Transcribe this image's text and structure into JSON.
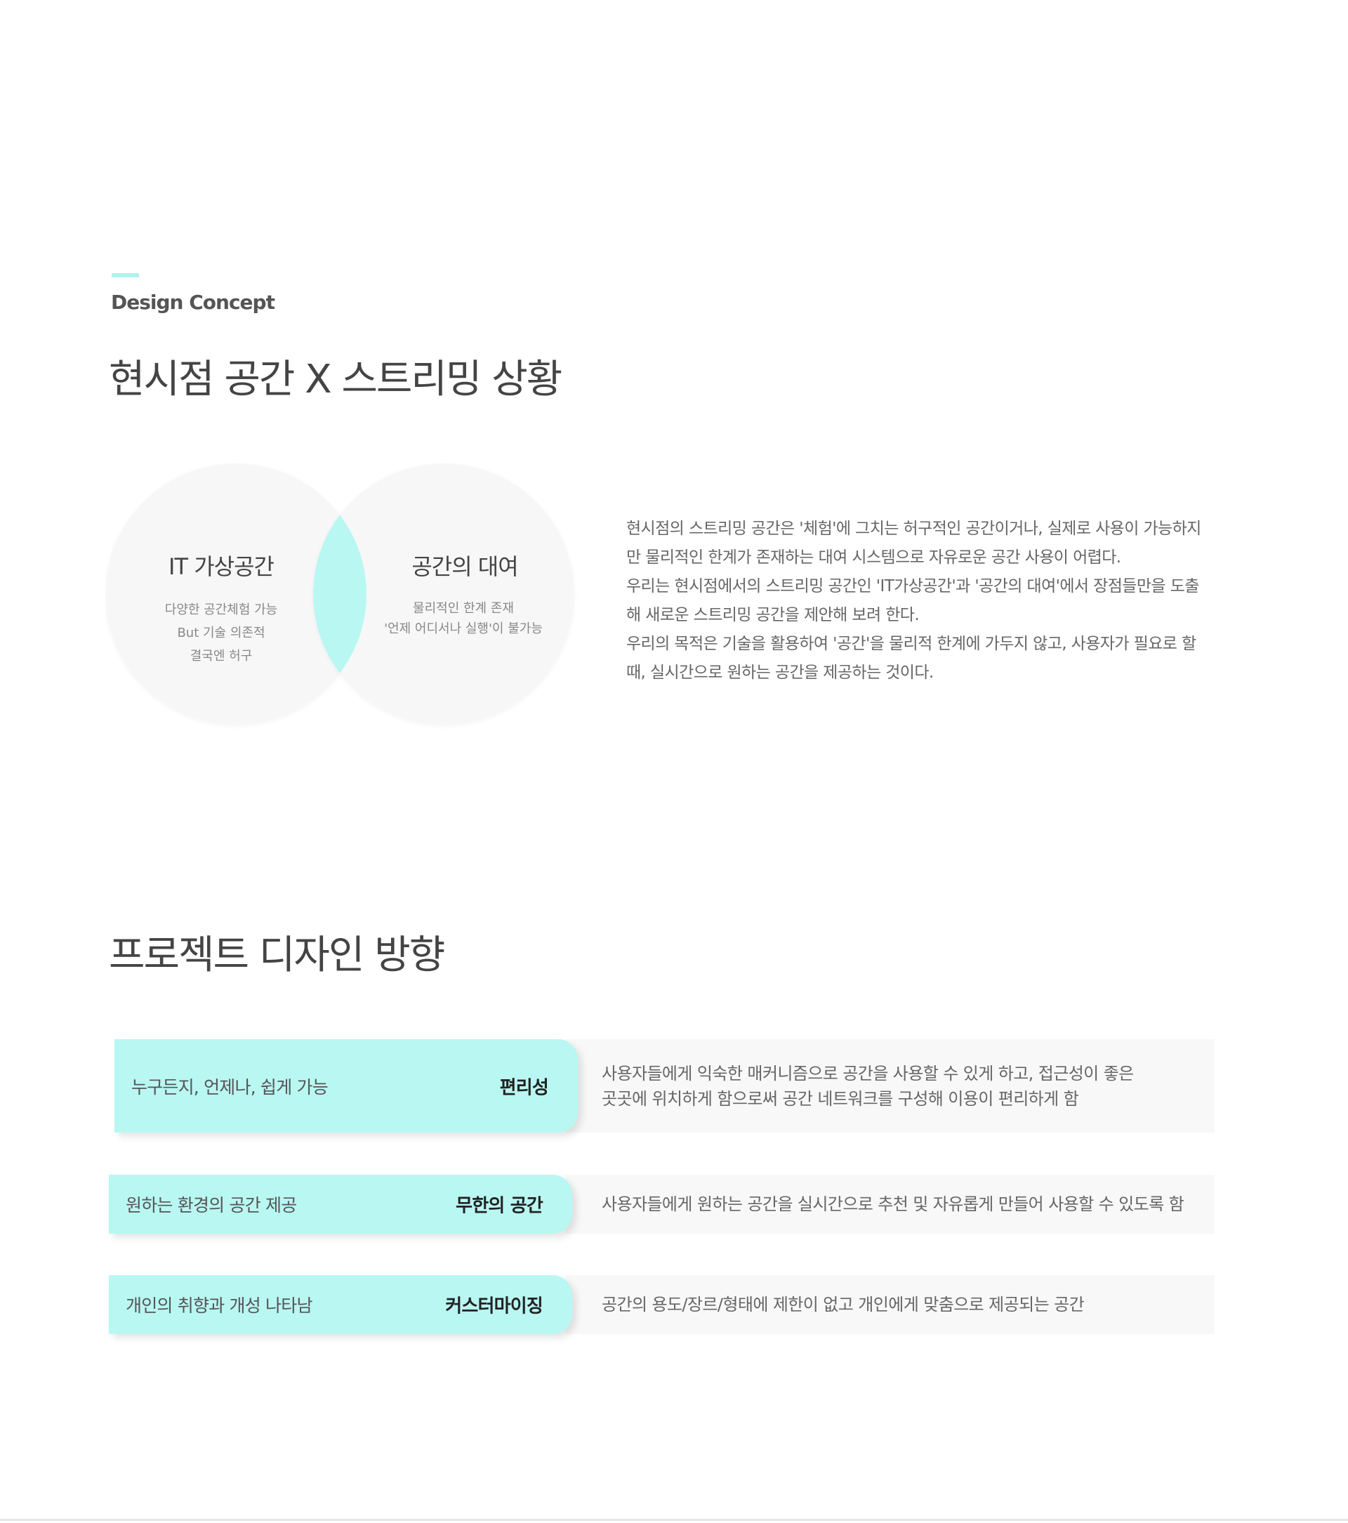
{
  "section_label": "Design Concept",
  "headline_1": "현시점 공간 X 스트리밍 상황",
  "venn": {
    "left": {
      "title": "IT 가상공간",
      "lines": [
        "다양한 공간체험 가능",
        "But 기술 의존적",
        "결국엔 허구"
      ]
    },
    "right": {
      "title": "공간의 대여",
      "lines": [
        "물리적인 한계 존재",
        "'언제 어디서나 실행'이 불가능"
      ]
    }
  },
  "description": [
    "현시점의 스트리밍 공간은 '체험'에 그치는 허구적인 공간이거나, 실제로 사용이 가능하지만 물리적인 한계가 존재하는 대여 시스템으로 자유로운 공간 사용이 어렵다.",
    "우리는 현시점에서의 스트리밍 공간인 'IT가상공간'과 '공간의 대여'에서 장점들만을 도출해 새로운 스트리밍 공간을 제안해 보려 한다.",
    "우리의 목적은 기술을 활용하여 '공간'을 물리적 한계에 가두지 않고, 사용자가 필요로 할 때, 실시간으로 원하는 공간을 제공하는 것이다."
  ],
  "headline_2": "프로젝트 디자인 방향",
  "directions": [
    {
      "summary": "누구든지, 언제나, 쉽게 가능",
      "keyword": "편리성",
      "detail": [
        "사용자들에게 익숙한 매커니즘으로 공간을 사용할 수 있게 하고, 접근성이 좋은",
        "곳곳에 위치하게 함으로써 공간 네트워크를 구성해 이용이 편리하게 함"
      ]
    },
    {
      "summary": "원하는 환경의 공간 제공",
      "keyword": "무한의 공간",
      "detail": [
        "사용자들에게 원하는 공간을 실시간으로 추천 및 자유롭게 만들어 사용할 수 있도록 함"
      ]
    },
    {
      "summary": "개인의 취향과 개성 나타남",
      "keyword": "커스터마이징",
      "detail": [
        "공간의 용도/장르/형태에 제한이 없고 개인에게 맞춤으로 제공되는 공간"
      ]
    }
  ],
  "colors": {
    "accent": "#aef3ee",
    "pill": "#b9f7f2",
    "circle": "#f7f7f7",
    "overlap": "#b9f7f2"
  }
}
